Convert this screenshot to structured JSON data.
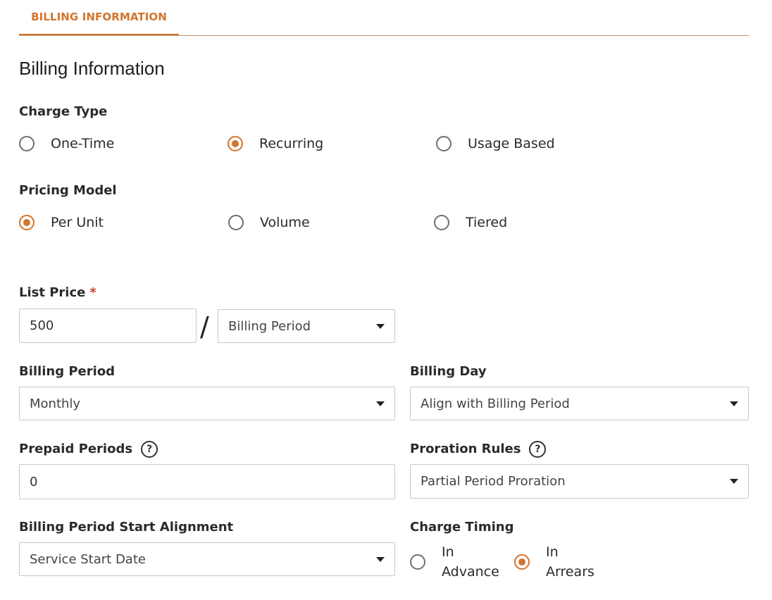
{
  "tabs": [
    {
      "label": "BILLING INFORMATION"
    }
  ],
  "page_title": "Billing Information",
  "charge_type": {
    "label": "Charge Type",
    "options": [
      {
        "label": "One-Time",
        "checked": false
      },
      {
        "label": "Recurring",
        "checked": true
      },
      {
        "label": "Usage Based",
        "checked": false
      }
    ]
  },
  "pricing_model": {
    "label": "Pricing Model",
    "options": [
      {
        "label": "Per Unit",
        "checked": true
      },
      {
        "label": "Volume",
        "checked": false
      },
      {
        "label": "Tiered",
        "checked": false
      }
    ]
  },
  "list_price": {
    "label": "List Price",
    "required_mark": "*",
    "value": "500",
    "separator": "/",
    "period_select": "Billing Period"
  },
  "billing_period": {
    "label": "Billing Period",
    "value": "Monthly"
  },
  "billing_day": {
    "label": "Billing Day",
    "value": "Align with Billing Period"
  },
  "prepaid_periods": {
    "label": "Prepaid Periods",
    "value": "0",
    "help_icon": "question-circle-icon"
  },
  "proration_rules": {
    "label": "Proration Rules",
    "value": "Partial Period Proration",
    "help_icon": "question-circle-icon"
  },
  "start_alignment": {
    "label": "Billing Period Start Alignment",
    "value": "Service Start Date"
  },
  "charge_timing": {
    "label": "Charge Timing",
    "options": [
      {
        "line1": "In",
        "line2": "Advance",
        "checked": false
      },
      {
        "line1": "In",
        "line2": "Arrears",
        "checked": true
      }
    ]
  },
  "colors": {
    "accent": "#d4742b",
    "required": "#c8402e"
  }
}
